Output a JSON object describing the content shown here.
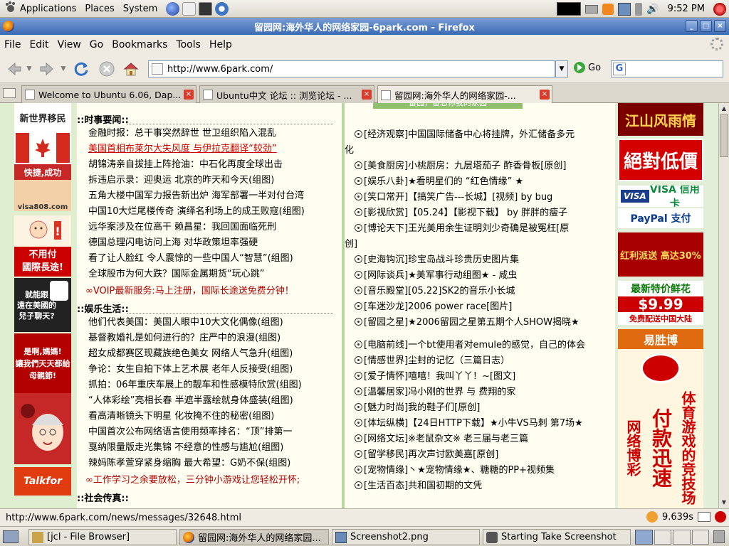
{
  "panel": {
    "menus": [
      "Applications",
      "Places",
      "System"
    ],
    "clock": "9:52 PM"
  },
  "window": {
    "title": "留园网:海外华人的网络家园-6park.com - Firefox"
  },
  "menubar": {
    "items": [
      "File",
      "Edit",
      "View",
      "Go",
      "Bookmarks",
      "Tools",
      "Help"
    ],
    "underline": [
      "F",
      "E",
      "V",
      "G",
      "B",
      "T",
      "H"
    ]
  },
  "navbar": {
    "url": "http://www.6park.com/",
    "go_label": "Go"
  },
  "tabs": [
    {
      "label": "Welcome to Ubuntu 6.06, Dap..."
    },
    {
      "label": "Ubuntu中文 论坛 :: 浏览论坛 - ..."
    },
    {
      "label": "留园网:海外华人的网络家园-..."
    }
  ],
  "page": {
    "left_ads": [
      {
        "text": "新世界移民"
      },
      {
        "text": "快捷,成功"
      },
      {
        "text": "visa808.com"
      },
      {
        "text": "不用付\n國際長途!"
      },
      {
        "text": "就能跟\n遠在美國的\n兒子聊天?"
      },
      {
        "text": "是啊,媽媽!\n讓我們天天都給\n母親節!"
      },
      {
        "text": "Talkfor"
      }
    ],
    "section1_title": "::时事要闻::",
    "section1": [
      "金融时报：总干事突然辞世 世卫组织陷入混乱",
      "美国首相布莱尔大失风度 与伊拉克翻译“较劲”",
      "胡锦涛亲自拔挂上阵抢油：中石化再度全球出击",
      "拆违启示录：迎奥运 北京的昨天和今天(组图)",
      "五角大楼中国军力报告新出炉 海军部署一半对付台湾",
      "中国10大烂尾楼传奇 演绎名利场上的成王败寇(组图)",
      "远华案涉及在位高干 赖昌星：我回国面临死刑",
      "德国总理闪电访问上海 对华政策坦率强硬",
      "看了让人脸红 令人震惊的一些中国人“智慧”(组图)",
      "全球股市为何大跌？国际金属期货“玩心跳”"
    ],
    "section1_promo": "∞VOIP最新服务:马上注册，国际长途送免费分钟！",
    "section2_title": "::娱乐生活::",
    "section2": [
      "他们代表美国：美国人眼中10大文化偶像(组图)",
      "基督教婚礼是如何进行的？庄严中的浪漫(组图)",
      "超女成都赛区现藏族绝色美女 网络人气急升(组图)",
      "争论：女生自拍下体上艺术展 老年人反接受(组图)",
      "抓拍：06年重庆车展上的靓车和性感模特欣赏(组图)",
      "“人体彩绘”亮相长春 半遮半露绘就身体盛装(组图)",
      "看高清晰镜头下明星 化妆掩不住的秘密(组图)",
      "中国首次公布网络语言使用频率排名：“顶”排第一",
      "戛纳限量版走光集锦 不经意的性感与尴尬(组图)",
      "辣妈陈孝萱穿紧身缩胸 最大希望：G奶不保(组图)"
    ],
    "section2_promo": "∞工作学习之余要放松，三分钟小游戏让您轻松开怀;",
    "section3_title": "::社会传真::",
    "right_top_banner": "留园，留恋你我的家园",
    "right_col": [
      {
        "text": "[经济观察]中国国际储备中心将挂牌，外汇储备多元",
        "wrap": "化"
      },
      {
        "text": "[美食厨房]小桃厨房：九层塔茄子 酢香骨板[原创]"
      },
      {
        "text": "[娱乐八卦]★看明星们的 “红色情缘” ★"
      },
      {
        "text": "[笑口常开]【搞笑广告---长城】[视频] by bug"
      },
      {
        "text": "[影视欣赏]【05.24】【影视下载】 by 胖胖的瘦子"
      },
      {
        "text": "[博论天下]王光美用余生证明刘少奇确是被冤枉[原",
        "wrap": "创]"
      },
      {
        "text": "[史海钩沉]珍宝岛战斗珍贵历史图片集"
      },
      {
        "text": "[网际谈兵]★美军事行动组图★ - 咸虫"
      },
      {
        "text": "[音乐殿堂][05.22]SK2的音乐小长城"
      },
      {
        "text": "[车迷沙龙]2006 power race[图片]"
      },
      {
        "text": "[留园之星]★2006留园之星第五期个人SHOW揭晓★"
      },
      {
        "text": "[电脑前线]一个bt使用者对emule的感觉，自己的体会"
      },
      {
        "text": "[情感世界]尘封的记忆（三篇日志）"
      },
      {
        "text": "[爱子情怀]嘻嘻！我叫丫丫！~[图文]"
      },
      {
        "text": "[温馨居家]冯小刚的世界 与 费翔的家"
      },
      {
        "text": "[魅力时尚]我的鞋子们[原创]"
      },
      {
        "text": "[体坛纵横]【24日HTTP下载】★小牛VS马刺 第7场★"
      },
      {
        "text": "[网络文坛]※老鼠杂文※ 老三届与老三篇"
      },
      {
        "text": "[留学移民]再次声讨欧美嘉[原创]"
      },
      {
        "text": "[宠物情缘]丶★宠物情缘★、糖糖的PP+视频集"
      },
      {
        "text": "[生活百态]共和国初期的文凭"
      }
    ],
    "right_ads": [
      {
        "text": "江山风雨情"
      },
      {
        "text": "絕對低價"
      },
      {
        "text": "VISA 信用卡"
      },
      {
        "text": "PayPal 支付"
      },
      {
        "text": "红利派送 高达30%"
      },
      {
        "text": "最新特价鲜花"
      },
      {
        "text": "$9.99"
      },
      {
        "text": "免费配送中国大陆"
      },
      {
        "text": "易胜博"
      },
      {
        "text": "付款迅速"
      },
      {
        "text": "体育游戏的竞技场"
      },
      {
        "text": "网络博彩"
      }
    ]
  },
  "statusbar": {
    "url": "http://www.6park.com/news/messages/32648.html",
    "timing": "9.639s"
  },
  "taskbar": [
    {
      "label": "[jcl - File Browser]"
    },
    {
      "label": "留园网:海外华人的网络家园..."
    },
    {
      "label": "Screenshot2.png"
    },
    {
      "label": "Starting Take Screenshot"
    }
  ]
}
